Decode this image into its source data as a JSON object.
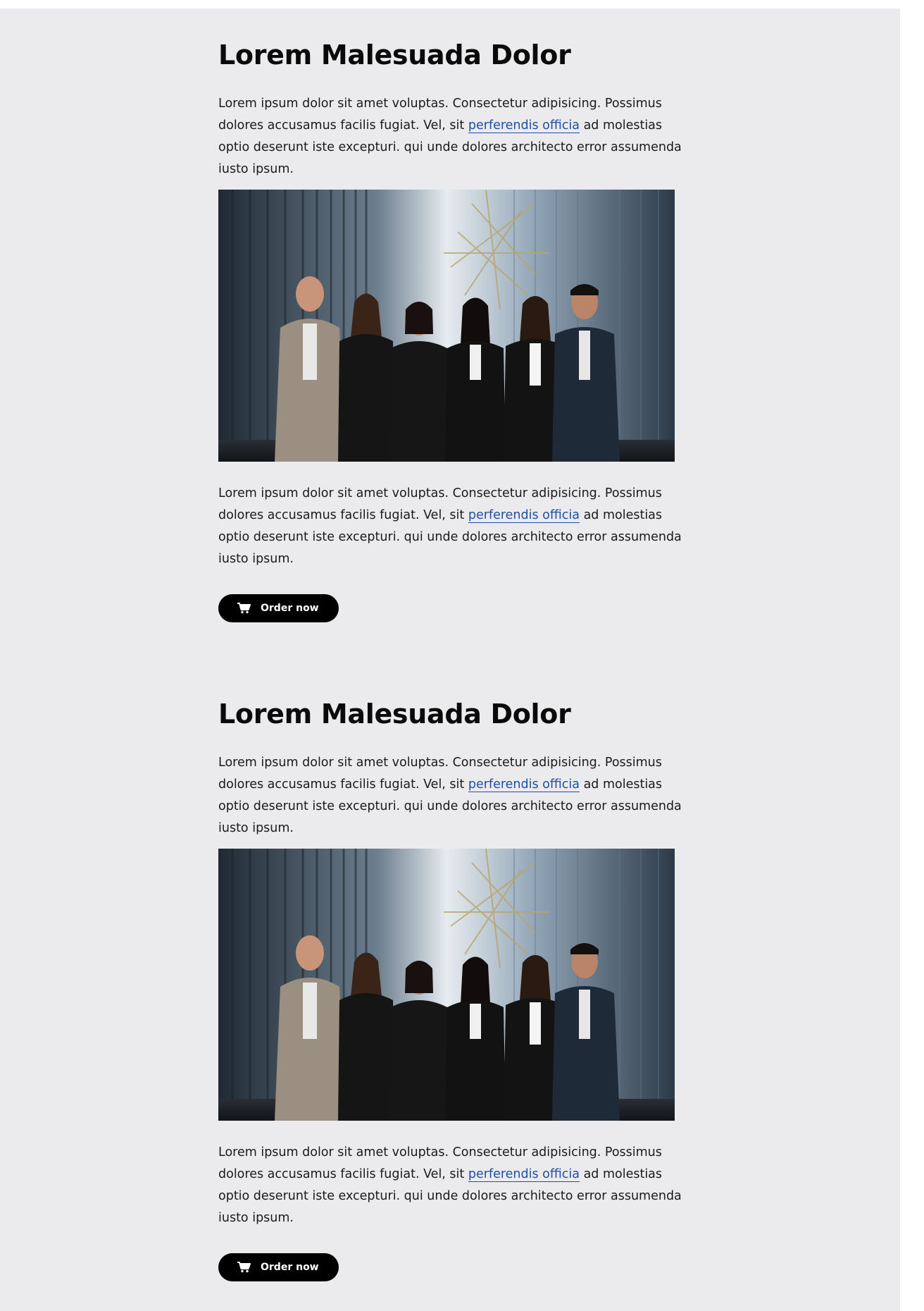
{
  "articles": [
    {
      "title": "Lorem Malesuada Dolor",
      "intro": {
        "before_link": "Lorem ipsum dolor sit amet voluptas. Consectetur adipisicing. Possimus dolores accusamus facilis fugiat. Vel, sit ",
        "link_text": "perferendis officia",
        "after_link": " ad molestias optio deserunt iste excepturi. qui unde dolores architecto error assumenda iusto ipsum."
      },
      "body": {
        "before_link": "Lorem ipsum dolor sit amet voluptas. Consectetur adipisicing. Possimus dolores accusamus facilis fugiat. Vel, sit ",
        "link_text": "perferendis officia",
        "after_link": " ad molestias optio deserunt iste excepturi. qui unde dolores architecto error assumenda iusto ipsum."
      },
      "button_label": "Order now",
      "button_icon": "cart-icon"
    },
    {
      "title": "Lorem Malesuada Dolor",
      "intro": {
        "before_link": "Lorem ipsum dolor sit amet voluptas. Consectetur adipisicing. Possimus dolores accusamus facilis fugiat. Vel, sit ",
        "link_text": "perferendis officia",
        "after_link": " ad molestias optio deserunt iste excepturi. qui unde dolores architecto error assumenda iusto ipsum."
      },
      "body": {
        "before_link": "Lorem ipsum dolor sit amet voluptas. Consectetur adipisicing. Possimus dolores accusamus facilis fugiat. Vel, sit ",
        "link_text": "perferendis officia",
        "after_link": " ad molestias optio deserunt iste excepturi. qui unde dolores architecto error assumenda iusto ipsum."
      },
      "button_label": "Order now",
      "button_icon": "cart-icon"
    }
  ],
  "colors": {
    "page_background": "#ebebed",
    "link": "#1f4fa3",
    "button_background": "#000000",
    "button_text": "#ffffff"
  }
}
